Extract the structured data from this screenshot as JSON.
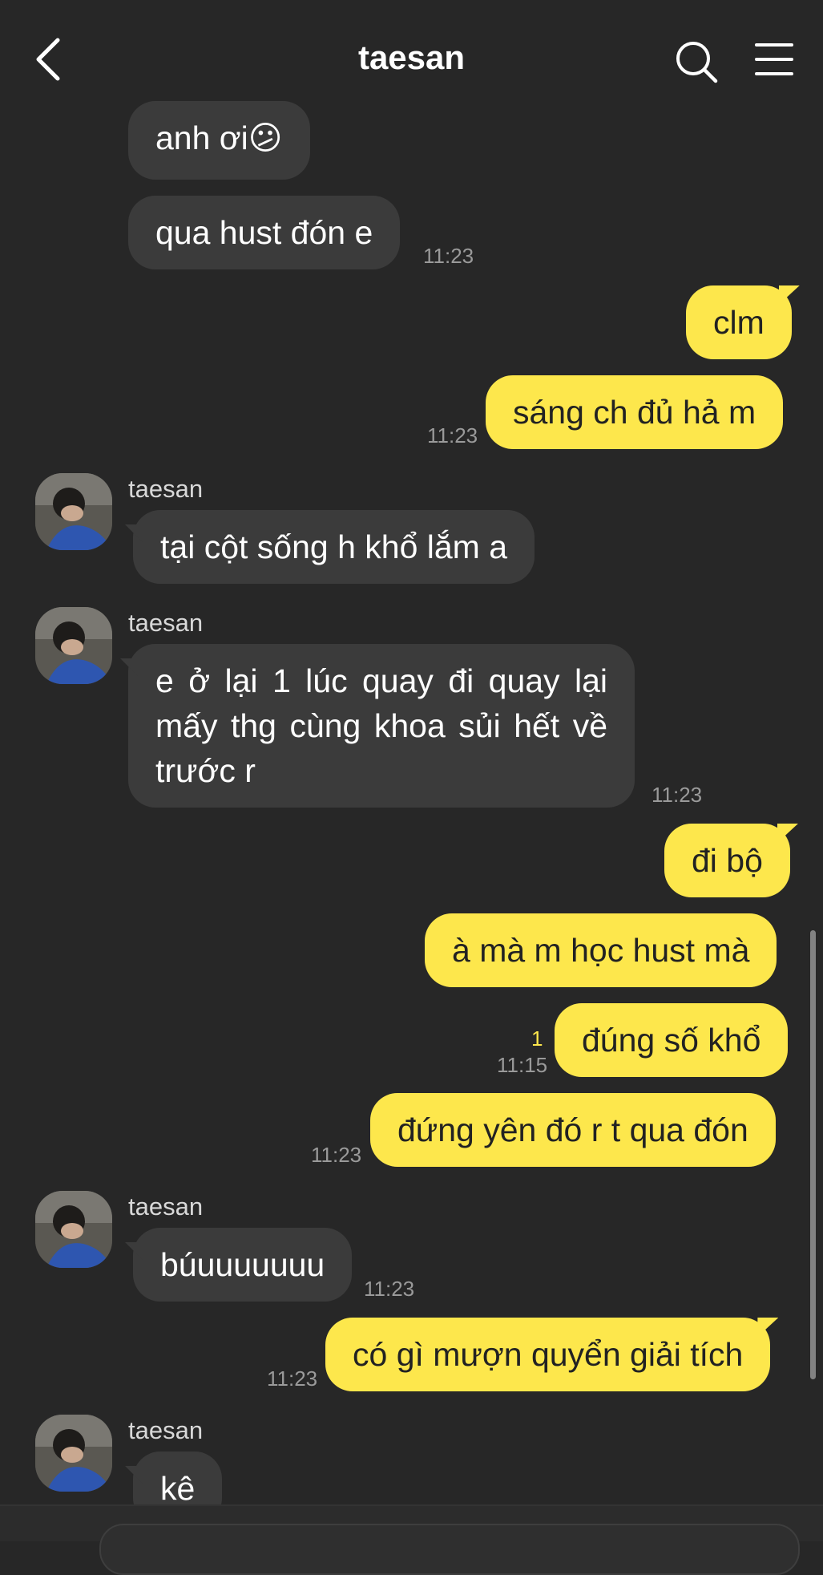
{
  "header": {
    "title": "taesan",
    "back_icon": "chevron-left-icon",
    "search_icon": "search-icon",
    "menu_icon": "hamburger-menu-icon"
  },
  "colors": {
    "background": "#272727",
    "incoming_bubble": "#3b3b3b",
    "outgoing_bubble": "#fde74c",
    "timestamp": "#9a9a9a",
    "unread": "#fde74c"
  },
  "messages": [
    {
      "dir": "in",
      "text": "anh ơi😕"
    },
    {
      "dir": "in",
      "text": "qua hust đón e",
      "time": "11:23"
    },
    {
      "dir": "out",
      "text": "clm"
    },
    {
      "dir": "out",
      "text": "sáng ch đủ hả m",
      "time": "11:23"
    },
    {
      "dir": "in",
      "sender": "taesan",
      "text": "tại cột sống h khổ lắm a"
    },
    {
      "dir": "in",
      "sender": "taesan",
      "text": "e ở lại 1 lúc quay đi quay lại mấy thg cùng khoa sủi hết về trước r",
      "time": "11:23"
    },
    {
      "dir": "out",
      "text": "đi bộ"
    },
    {
      "dir": "out",
      "text": "à mà m học hust mà"
    },
    {
      "dir": "out",
      "text": "đúng số khổ",
      "time": "11:15",
      "unread": "1"
    },
    {
      "dir": "out",
      "text": "đứng yên đó r t qua đón",
      "time": "11:23"
    },
    {
      "dir": "in",
      "sender": "taesan",
      "text": "búuuuuuuu",
      "time": "11:23"
    },
    {
      "dir": "out",
      "text": "có gì mượn quyển giải tích",
      "time": "11:23"
    },
    {
      "dir": "in",
      "sender": "taesan",
      "text": "kê"
    }
  ]
}
